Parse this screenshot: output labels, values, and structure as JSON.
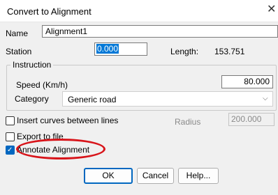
{
  "window": {
    "title": "Convert to Alignment",
    "close_glyph": "✕"
  },
  "name": {
    "label": "Name",
    "value": "Alignment1"
  },
  "station": {
    "label": "Station",
    "value": "0.000"
  },
  "length": {
    "label": "Length:",
    "value": "153.751"
  },
  "instruction": {
    "title": "Instruction",
    "speed_label": "Speed (Km/h)",
    "speed_value": "80.000",
    "category_label": "Category",
    "category_value": "Generic road"
  },
  "insert_curves": {
    "label": "Insert curves between lines",
    "checked": false
  },
  "radius": {
    "label": "Radius",
    "value": "200.000"
  },
  "export_to_file": {
    "label": "Export to file",
    "checked": false
  },
  "annotate_alignment": {
    "label": "Annotate Alignment",
    "checked": true
  },
  "buttons": {
    "ok": "OK",
    "cancel": "Cancel",
    "help": "Help..."
  },
  "colors": {
    "accent": "#0067c0",
    "annotation": "#d8141a",
    "selection": "#0078d7"
  }
}
